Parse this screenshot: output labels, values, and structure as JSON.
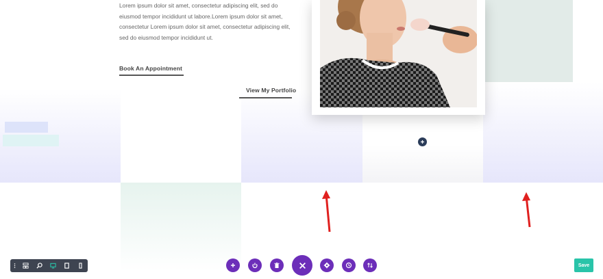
{
  "content": {
    "paragraph": "Lorem ipsum dolor sit amet, consectetur adipiscing elit, sed do eiusmod tempor incididunt ut labore.Lorem ipsum dolor sit amet, consectetur Lorem ipsum dolor sit amet, consectetur adipiscing elit, sed do eiusmod tempor incididunt ut.",
    "primary_link": "Book An Appointment",
    "secondary_link": "View My Portfolio"
  },
  "builder": {
    "bottom_controls": [
      {
        "name": "add-module-button",
        "icon": "plus-icon"
      },
      {
        "name": "power-button",
        "icon": "power-icon"
      },
      {
        "name": "delete-button",
        "icon": "trash-icon"
      },
      {
        "name": "close-button",
        "icon": "close-icon"
      },
      {
        "name": "settings-button",
        "icon": "gear-icon"
      },
      {
        "name": "history-button",
        "icon": "clock-icon"
      },
      {
        "name": "sort-button",
        "icon": "sort-icon"
      }
    ],
    "view_toolbar": [
      "menu-dots-icon",
      "wireframe-icon",
      "zoom-icon",
      "desktop-icon",
      "tablet-icon",
      "phone-icon"
    ],
    "active_view": "desktop",
    "save_label": "Save"
  },
  "colors": {
    "accent_purple": "#6c2eb9",
    "save_green": "#29c4a9",
    "toolbar_dark": "#3e4451",
    "arrow_red": "#e0201f",
    "lavender": "#e6e6fb",
    "mint": "#e6f3ee"
  }
}
